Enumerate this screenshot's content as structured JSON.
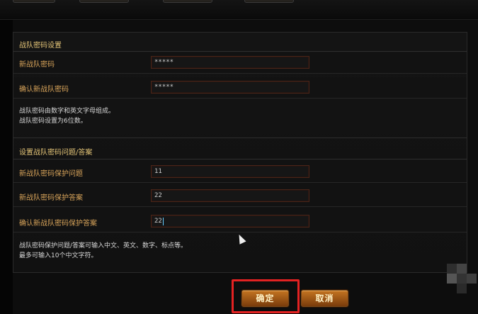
{
  "form": {
    "section_password": {
      "title": "战队密码设置"
    },
    "new_password": {
      "label": "新战队密码",
      "value": "*****"
    },
    "confirm_password": {
      "label": "确认新战队密码",
      "value": "*****"
    },
    "password_notes": [
      "战队密码由数字和英文字母组成。",
      "战队密码设置为6位数。"
    ],
    "section_question": {
      "title": "设置战队密码问题/答案"
    },
    "question": {
      "label": "新战队密码保护问题",
      "value": "11"
    },
    "answer": {
      "label": "新战队密码保护答案",
      "value": "22"
    },
    "confirm_answer": {
      "label": "确认新战队密码保护答案",
      "value": "22"
    },
    "question_notes": [
      "战队密码保护问题/答案可输入中文、英文、数字、标点等。",
      "最多可输入10个中文字符。"
    ]
  },
  "buttons": {
    "confirm": "确定",
    "cancel": "取消"
  },
  "colors": {
    "accent_label": "#d8a45a",
    "section_title": "#e3c477",
    "button": "#c47421",
    "highlight": "#e32222"
  }
}
